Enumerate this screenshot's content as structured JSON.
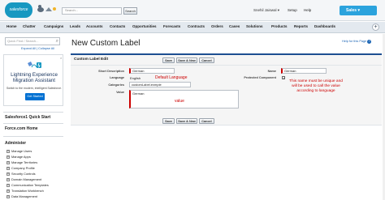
{
  "header": {
    "logo_text": "salesforce",
    "search_placeholder": "Search...",
    "search_button": "Search",
    "user_name": "Snehil Jaiswal ▾",
    "setup": "Setup",
    "help": "Help",
    "app_menu": "Sales ▾"
  },
  "tabs": [
    "Home",
    "Chatter",
    "Campaigns",
    "Leads",
    "Accounts",
    "Contacts",
    "Opportunities",
    "Forecasts",
    "Contracts",
    "Orders",
    "Cases",
    "Solutions",
    "Products",
    "Reports",
    "Dashboards"
  ],
  "tab_add": "+",
  "sidebar": {
    "quick_find_placeholder": "Quick Find / Search...",
    "expand_all": "Expand All",
    "collapse_all": "Collapse All",
    "expand_sep": "|",
    "lightning_title": "Lightning Experience Migration Assistant",
    "lightning_subtitle": "Switch to the modern, intelligent Salesforce.",
    "get_started": "Get Started",
    "close": "×",
    "quick_start": "Salesforce1 Quick Start",
    "force_home": "Force.com Home",
    "administer": "Administer",
    "admin_items": [
      "Manage Users",
      "Manage Apps",
      "Manage Territories",
      "Company Profile",
      "Security Controls",
      "Domain Management",
      "Communication Templates",
      "Translation Workbench",
      "Data Management"
    ]
  },
  "main": {
    "page_title": "New Custom Label",
    "help_page": "Help for this Page",
    "section_title": "Custom Label Edit",
    "buttons": {
      "save": "Save",
      "save_new": "Save & New",
      "cancel": "Cancel"
    },
    "fields": {
      "short_description_label": "Short Description",
      "short_description_value": "German",
      "language_label": "Language",
      "language_value": "English",
      "categories_label": "Categories",
      "categories_value": "customLabel.exmple",
      "value_label": "Value",
      "value_value": "German",
      "name_label": "Name",
      "name_value": "German",
      "protected_label": "Protected Component",
      "protected_checked": "✓"
    },
    "annotations": {
      "default_language": "Default Language",
      "value": "value",
      "name_note": "This name must be unique and will be used to call the value according to language"
    }
  },
  "colors": {
    "accent": "#1798c1",
    "app_menu": "#2ba3dd",
    "panel_border": "#1d4f91",
    "required": "#cc0000",
    "annotation": "#cc0000",
    "link": "#1a64b4",
    "get_started": "#0070d2"
  }
}
